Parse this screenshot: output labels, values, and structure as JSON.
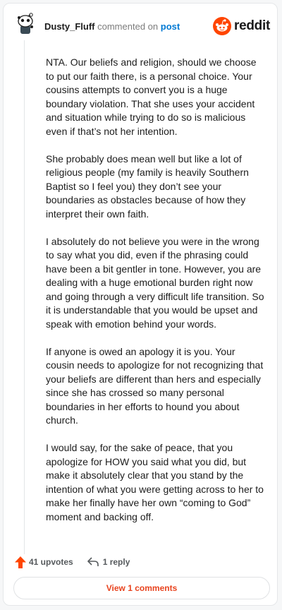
{
  "header": {
    "username": "Dusty_Fluff",
    "action": "commented on",
    "link": "post",
    "brand": "reddit"
  },
  "comment": {
    "paragraphs": [
      "NTA. Our beliefs and religion, should we choose to put our faith there, is a personal choice. Your cousins attempts to convert you is a huge boundary violation. That she uses your accident and situation while trying to do so is malicious even if that’s not her intention.",
      "She probably does mean well but like a lot of religious people (my family is heavily Southern Baptist so I feel you) they don’t see your boundaries as obstacles because of how they interpret their own faith.",
      "I absolutely do not believe you were in the wrong to say what you did, even if the phrasing could have been a bit gentler in tone. However, you are dealing with a huge emotional burden right now and going through a very difficult life transition. So it is understandable that you would be upset and speak with emotion behind your words.",
      "If anyone is owed an apology it is you. Your cousin needs to apologize for not recognizing that your beliefs are different than hers and especially since she has crossed so many personal boundaries in her efforts to hound you about church.",
      "I would say, for the sake of peace, that you apologize for HOW you said what you did, but make it absolutely clear that you stand by the intention of what you were getting across to her to make her finally have her own “coming to God” moment and backing off."
    ]
  },
  "footer": {
    "upvotes": "41 upvotes",
    "replies": "1 reply",
    "view_button": "View 1 comments"
  },
  "colors": {
    "accent": "#ff4500",
    "link": "#0079d3",
    "view_text": "#e8431e"
  }
}
